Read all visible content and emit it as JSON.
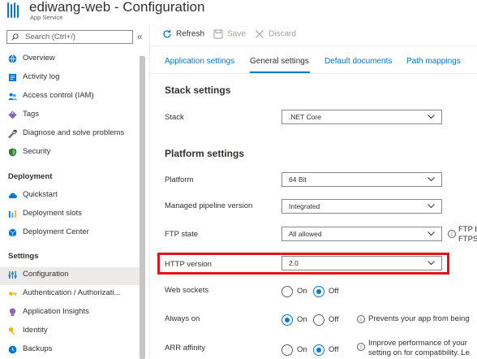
{
  "header": {
    "title": "ediwang-web - Configuration",
    "subtitle": "App Service"
  },
  "sidebar": {
    "search_placeholder": "Search (Ctrl+/)",
    "collapse_glyph": "«",
    "items_top": [
      {
        "label": "Overview",
        "icon": "globe-icon"
      },
      {
        "label": "Activity log",
        "icon": "activity-log-icon"
      },
      {
        "label": "Access control (IAM)",
        "icon": "people-icon"
      },
      {
        "label": "Tags",
        "icon": "tag-icon"
      },
      {
        "label": "Diagnose and solve problems",
        "icon": "wrench-icon"
      },
      {
        "label": "Security",
        "icon": "shield-icon"
      }
    ],
    "section_deployment": "Deployment",
    "items_deployment": [
      {
        "label": "Quickstart",
        "icon": "cloud-icon"
      },
      {
        "label": "Deployment slots",
        "icon": "slots-icon"
      },
      {
        "label": "Deployment Center",
        "icon": "cube-icon"
      }
    ],
    "section_settings": "Settings",
    "items_settings": [
      {
        "label": "Configuration",
        "icon": "sliders-icon"
      },
      {
        "label": "Authentication / Authorizati...",
        "icon": "key-icon"
      },
      {
        "label": "Application Insights",
        "icon": "bulb-icon"
      },
      {
        "label": "Identity",
        "icon": "identity-key-icon"
      },
      {
        "label": "Backups",
        "icon": "backup-icon"
      }
    ]
  },
  "toolbar": {
    "refresh": "Refresh",
    "save": "Save",
    "discard": "Discard"
  },
  "tabs": [
    "Application settings",
    "General settings",
    "Default documents",
    "Path mappings"
  ],
  "active_tab": "General settings",
  "stack": {
    "heading": "Stack settings",
    "label": "Stack",
    "value": ".NET Core"
  },
  "platform": {
    "heading": "Platform settings",
    "platform_label": "Platform",
    "platform_value": "64 Bit",
    "pipeline_label": "Managed pipeline version",
    "pipeline_value": "Integrated",
    "ftp_label": "FTP state",
    "ftp_value": "All allowed",
    "ftp_info_1": "FTP b",
    "ftp_info_2": "FTPS",
    "http_label": "HTTP version",
    "http_value": "2.0",
    "websockets_label": "Web sockets",
    "alwayson_label": "Always on",
    "alwayson_info": "Prevents your app from being",
    "arr_label": "ARR affinity",
    "arr_info_1": "Improve performance of your",
    "arr_info_2": "setting on for compatibility. Le",
    "on": "On",
    "off": "Off"
  },
  "colors": {
    "accent": "#0078d4",
    "highlight": "#e3141c"
  }
}
